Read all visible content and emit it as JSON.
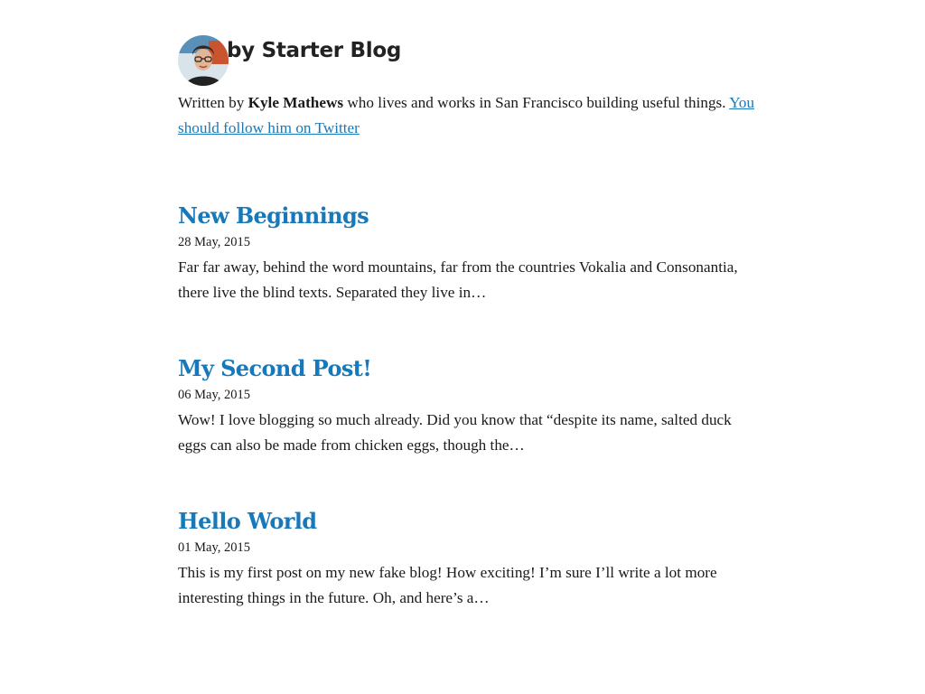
{
  "header": {
    "site_title": "by Starter Blog",
    "avatar_alt": "Kyle Mathews"
  },
  "bio": {
    "prefix": "Written by ",
    "author": "Kyle Mathews",
    "middle": " who lives and works in San Francisco building useful things. ",
    "twitter_link": "You should follow him on Twitter"
  },
  "posts": [
    {
      "title": "New Beginnings",
      "date": "28 May, 2015",
      "excerpt": "Far far away, behind the word mountains, far from the countries Vokalia and Consonantia, there live the blind texts. Separated they live in…"
    },
    {
      "title": "My Second Post!",
      "date": "06 May, 2015",
      "excerpt": "Wow! I love blogging so much already. Did you know that “despite its name, salted duck eggs can also be made from chicken eggs, though the…"
    },
    {
      "title": "Hello World",
      "date": "01 May, 2015",
      "excerpt": "This is my first post on my new fake blog! How exciting! I’m sure I’ll write a lot more interesting things in the future. Oh, and here’s a…"
    }
  ],
  "colors": {
    "link": "#1779ba",
    "text": "#1a1a1a"
  }
}
